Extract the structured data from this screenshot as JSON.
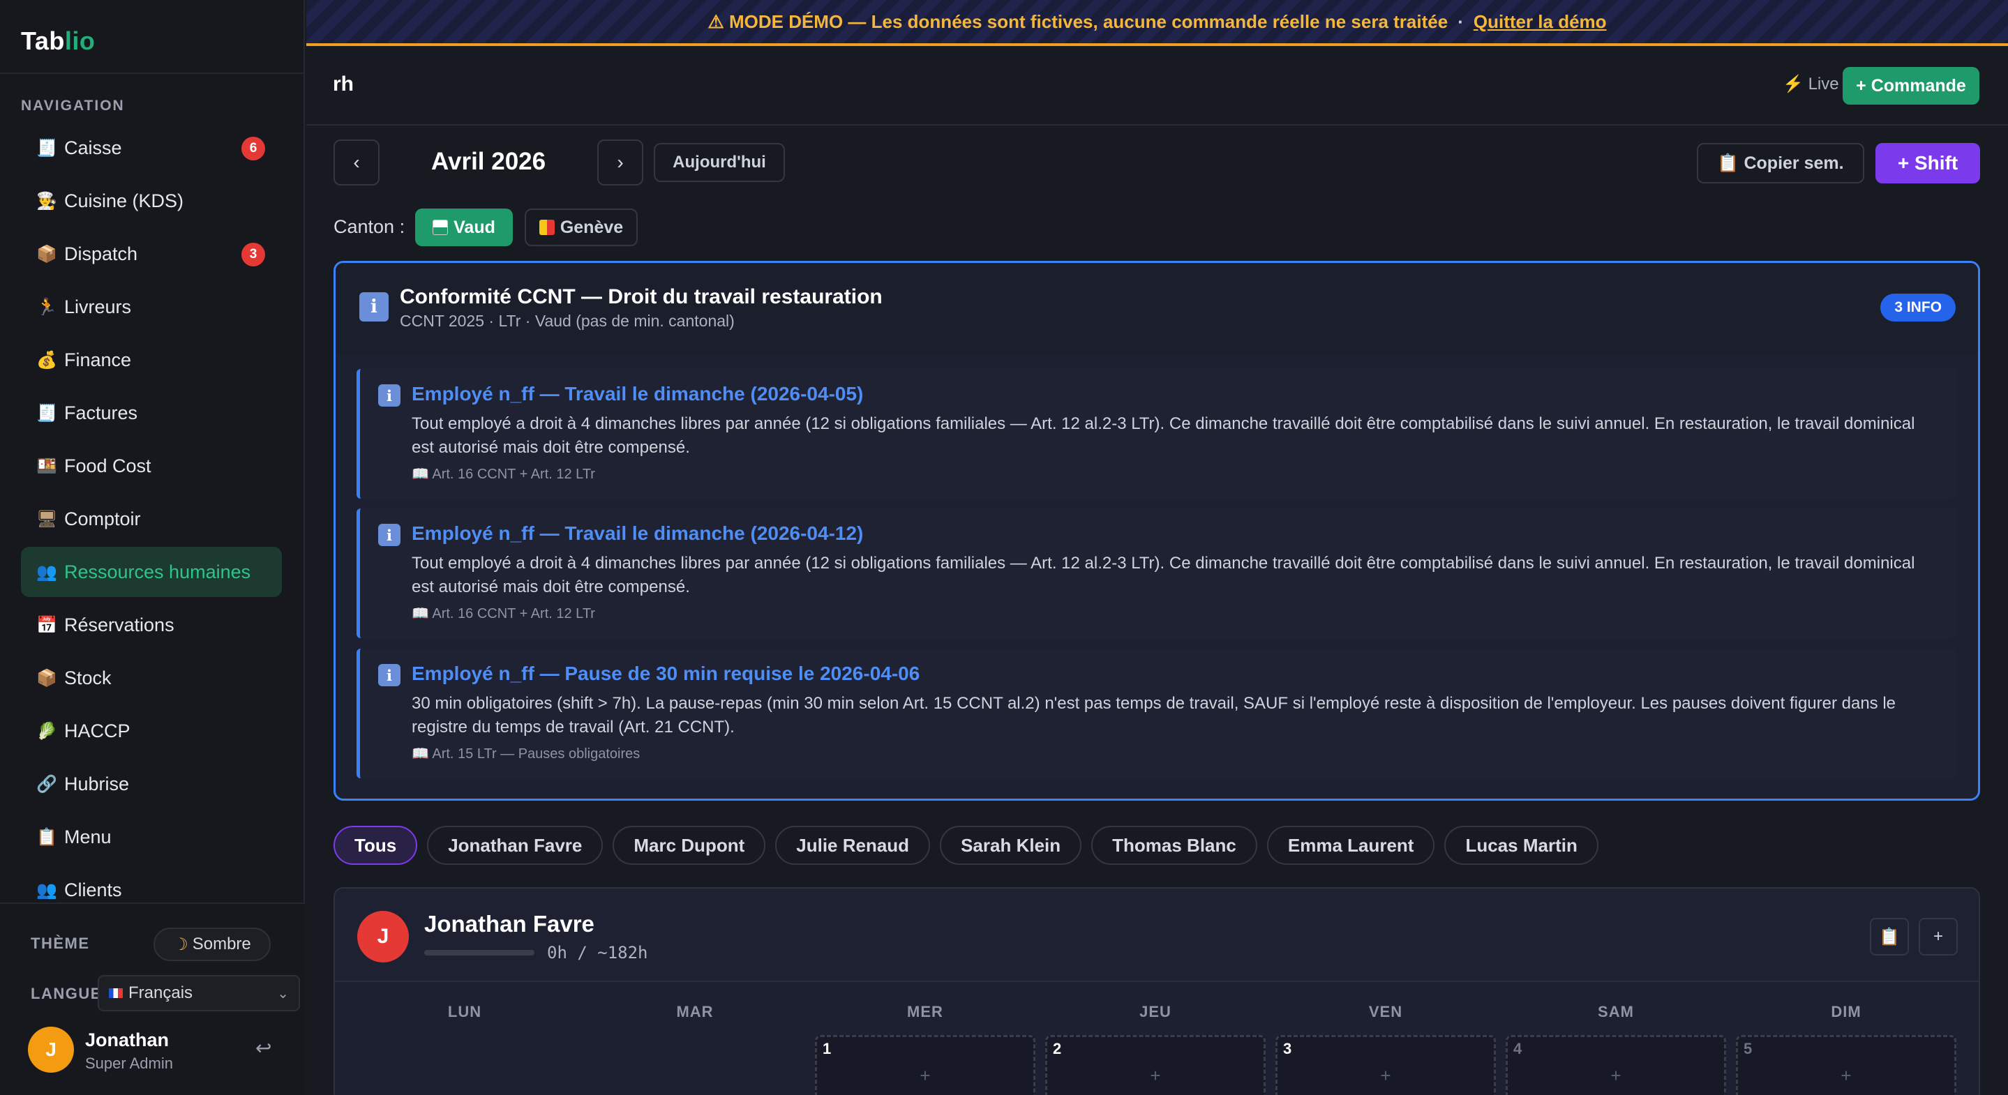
{
  "sidebar": {
    "logo_main": "Tab",
    "logo_accent": "lio",
    "nav_heading": "NAVIGATION",
    "items": [
      {
        "label": "Caisse",
        "badge": "6",
        "icon": "cash-register-icon"
      },
      {
        "label": "Cuisine (KDS)",
        "badge": "",
        "icon": "chef-icon"
      },
      {
        "label": "Dispatch",
        "badge": "3",
        "icon": "package-icon"
      },
      {
        "label": "Livreurs",
        "badge": "",
        "icon": "runner-icon"
      },
      {
        "label": "Finance",
        "badge": "",
        "icon": "money-bag-icon"
      },
      {
        "label": "Factures",
        "badge": "",
        "icon": "receipt-icon"
      },
      {
        "label": "Food Cost",
        "badge": "",
        "icon": "food-cost-icon"
      },
      {
        "label": "Comptoir",
        "badge": "",
        "icon": "monitor-icon"
      },
      {
        "label": "Ressources humaines",
        "badge": "",
        "icon": "people-icon"
      },
      {
        "label": "Réservations",
        "badge": "",
        "icon": "calendar-icon"
      },
      {
        "label": "Stock",
        "badge": "",
        "icon": "box-icon"
      },
      {
        "label": "HACCP",
        "badge": "",
        "icon": "leaf-icon"
      },
      {
        "label": "Hubrise",
        "badge": "",
        "icon": "link-icon"
      },
      {
        "label": "Menu",
        "badge": "",
        "icon": "clipboard-icon"
      },
      {
        "label": "Clients",
        "badge": "",
        "icon": "people-icon"
      }
    ],
    "active_index": 8,
    "theme_label": "THÈME",
    "theme_value": "Sombre",
    "lang_label": "LANGUE",
    "lang_value": "Français",
    "user": {
      "initial": "J",
      "name": "Jonathan",
      "role": "Super Admin"
    }
  },
  "banner": {
    "text": "⚠ MODE DÉMO — Les données sont fictives, aucune commande réelle ne sera traitée",
    "separator": "·",
    "quit_link": "Quitter la démo"
  },
  "topbar": {
    "title": "rh",
    "live_label": "Live",
    "command_button": "+ Commande"
  },
  "calendar": {
    "prev_label": "‹",
    "next_label": "›",
    "month": "Avril 2026",
    "today_button": "Aujourd'hui",
    "copy_button": "📋 Copier sem.",
    "shift_button": "+ Shift"
  },
  "canton": {
    "label": "Canton :",
    "options": [
      "Vaud",
      "Genève"
    ],
    "selected": "Vaud"
  },
  "compliance": {
    "title": "Conformité CCNT — Droit du travail restauration",
    "subtitle": "CCNT 2025 · LTr · Vaud (pas de min. cantonal)",
    "badge": "3 INFO",
    "rules": [
      {
        "title": "Employé n_ff — Travail le dimanche (2026-04-05)",
        "text": "Tout employé a droit à 4 dimanches libres par année (12 si obligations familiales — Art. 12 al.2-3 LTr). Ce dimanche travaillé doit être comptabilisé dans le suivi annuel. En restauration, le travail dominical est autorisé mais doit être compensé.",
        "ref": "📖 Art. 16 CCNT + Art. 12 LTr"
      },
      {
        "title": "Employé n_ff — Travail le dimanche (2026-04-12)",
        "text": "Tout employé a droit à 4 dimanches libres par année (12 si obligations familiales — Art. 12 al.2-3 LTr). Ce dimanche travaillé doit être comptabilisé dans le suivi annuel. En restauration, le travail dominical est autorisé mais doit être compensé.",
        "ref": "📖 Art. 16 CCNT + Art. 12 LTr"
      },
      {
        "title": "Employé n_ff — Pause de 30 min requise le 2026-04-06",
        "text": "30 min obligatoires (shift > 7h). La pause-repas (min 30 min selon Art. 15 CCNT al.2) n'est pas temps de travail, SAUF si l'employé reste à disposition de l'employeur. Les pauses doivent figurer dans le registre du temps de travail (Art. 21 CCNT).",
        "ref": "📖 Art. 15 LTr — Pauses obligatoires"
      }
    ]
  },
  "employee_filter": {
    "chips": [
      "Tous",
      "Jonathan Favre",
      "Marc Dupont",
      "Julie Renaud",
      "Sarah Klein",
      "Thomas Blanc",
      "Emma Laurent",
      "Lucas Martin"
    ],
    "selected": "Tous"
  },
  "employee_card": {
    "initial": "J",
    "name": "Jonathan Favre",
    "hours": "0h / ~182h",
    "progress": 0,
    "copy_icon": "📋",
    "add_icon": "+",
    "days": [
      "LUN",
      "MAR",
      "MER",
      "JEU",
      "VEN",
      "SAM",
      "DIM"
    ],
    "dates": [
      "",
      "",
      "1",
      "2",
      "3",
      "4",
      "5"
    ],
    "add_label": "+"
  }
}
